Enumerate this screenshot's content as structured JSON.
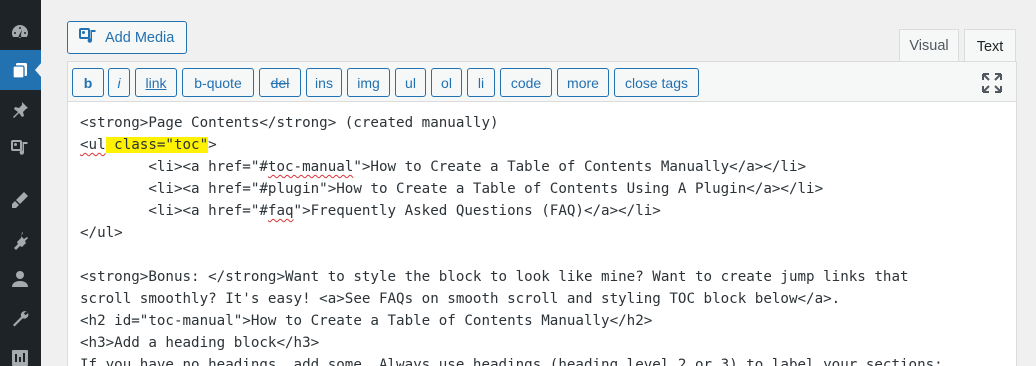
{
  "media": {
    "add_label": "Add Media"
  },
  "tabs": {
    "visual": "Visual",
    "text": "Text"
  },
  "toolbar": {
    "buttons": [
      "b",
      "i",
      "link",
      "b-quote",
      "del",
      "ins",
      "img",
      "ul",
      "ol",
      "li",
      "code",
      "more",
      "close tags"
    ]
  },
  "content": {
    "l1": "<strong>Page Contents</strong> (created manually)",
    "l2a": "<ul",
    "l2b": " class=\"toc\"",
    "l2c": ">",
    "l3a": "        <li><a href=\"#",
    "l3b": "toc-manual",
    "l3c": "\">How to Create a Table of Contents Manually</a></li>",
    "l4": "        <li><a href=\"#plugin\">How to Create a Table of Contents Using A Plugin</a></li>",
    "l5a": "        <li><a href=\"#",
    "l5b": "faq",
    "l5c": "\">Frequently Asked Questions (FAQ)</a></li>",
    "l6": "</ul>",
    "l7": "",
    "l8": "<strong>Bonus: </strong>Want to style the block to look like mine? Want to create jump links that",
    "l9": "scroll smoothly? It's easy! <a>See FAQs on smooth scroll and styling TOC block below</a>.",
    "l10": "<h2 id=\"toc-manual\">How to Create a Table of Contents Manually</h2>",
    "l11": "<h3>Add a heading block</h3>",
    "l12": "If you have no headings, add some. Always use headings (heading level 2 or 3) to label your sections;"
  },
  "colors": {
    "accent": "#2271b1",
    "highlight": "#fff200",
    "sidebar": "#1d2327"
  },
  "icons": [
    "dashboard-icon",
    "pages-icon",
    "pin-icon",
    "media-icon",
    "appearance-icon",
    "plugins-icon",
    "users-icon",
    "tools-icon",
    "settings-icon",
    "add-media-icon",
    "fullscreen-icon"
  ]
}
